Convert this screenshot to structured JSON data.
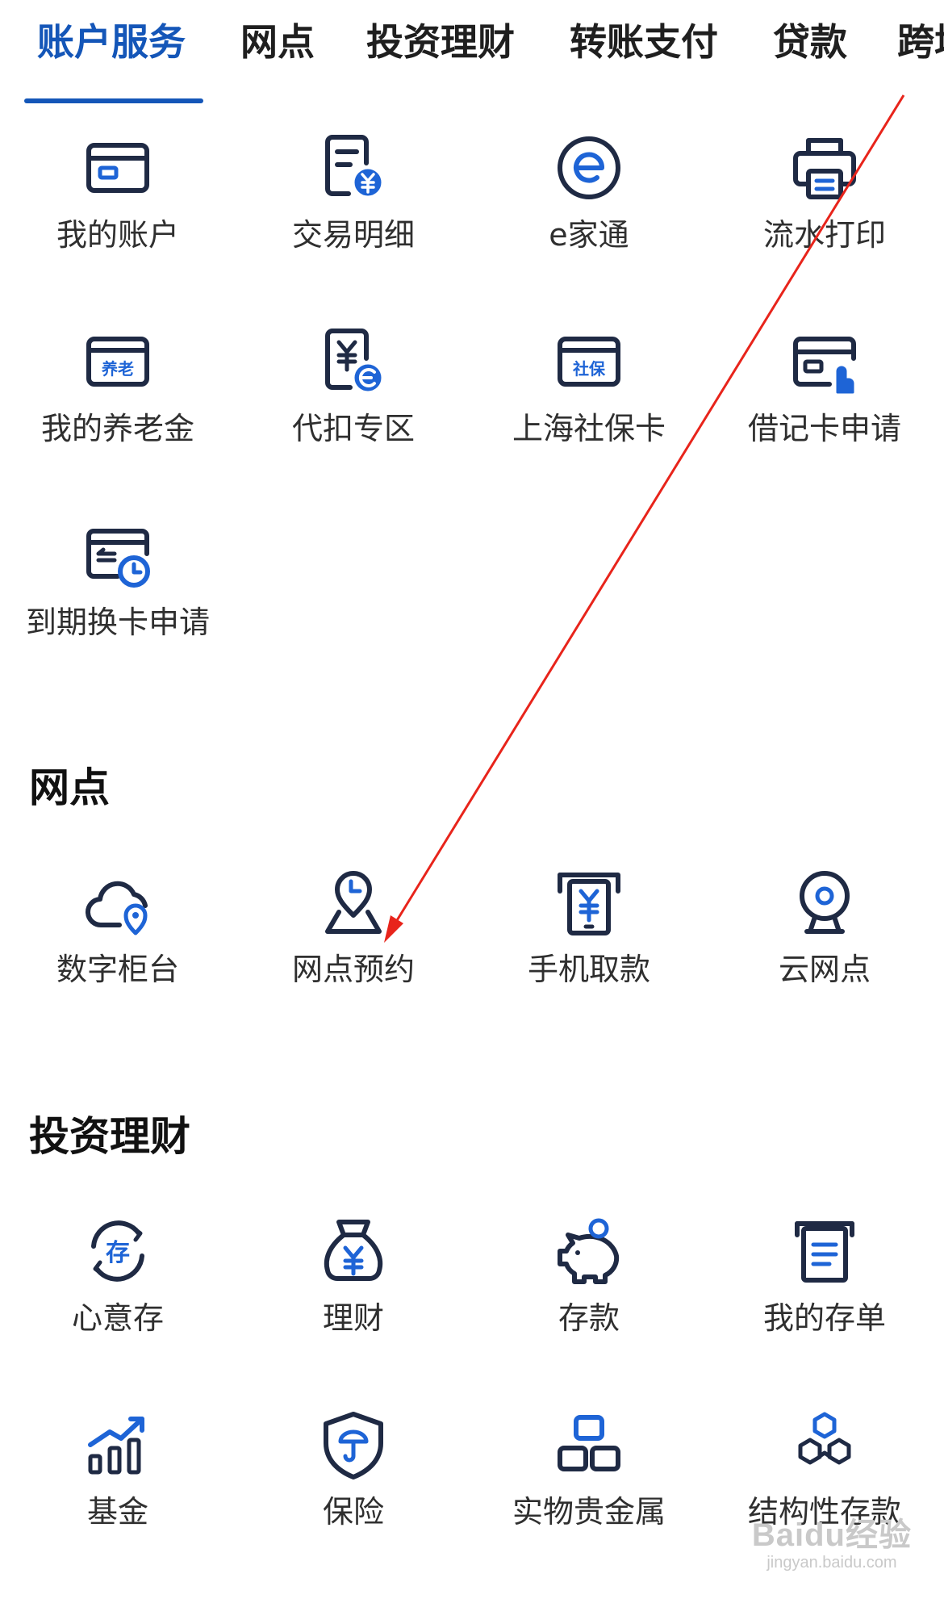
{
  "tabs": [
    {
      "label": "账户服务",
      "active": true
    },
    {
      "label": "网点",
      "active": false
    },
    {
      "label": "投资理财",
      "active": false
    },
    {
      "label": "转账支付",
      "active": false
    },
    {
      "label": "贷款",
      "active": false
    },
    {
      "label": "跨境",
      "active": false
    }
  ],
  "account_services": {
    "items": [
      {
        "label": "我的账户",
        "icon": "card-icon"
      },
      {
        "label": "交易明细",
        "icon": "transaction-detail-icon"
      },
      {
        "label": "e家通",
        "icon": "e-letter-icon"
      },
      {
        "label": "流水打印",
        "icon": "printer-icon"
      },
      {
        "label": "我的养老金",
        "icon": "pension-card-icon",
        "icon_text": "养老"
      },
      {
        "label": "代扣专区",
        "icon": "auto-debit-icon"
      },
      {
        "label": "上海社保卡",
        "icon": "social-security-card-icon",
        "icon_text": "社保"
      },
      {
        "label": "借记卡申请",
        "icon": "debit-card-apply-icon"
      },
      {
        "label": "到期换卡申请",
        "icon": "card-renewal-icon"
      }
    ]
  },
  "branch": {
    "title": "网点",
    "items": [
      {
        "label": "数字柜台",
        "icon": "cloud-location-icon"
      },
      {
        "label": "网点预约",
        "icon": "location-clock-icon"
      },
      {
        "label": "手机取款",
        "icon": "atm-withdraw-icon"
      },
      {
        "label": "云网点",
        "icon": "webcam-icon"
      }
    ]
  },
  "investment": {
    "title": "投资理财",
    "items": [
      {
        "label": "心意存",
        "icon": "deposit-cycle-icon",
        "icon_text": "存"
      },
      {
        "label": "理财",
        "icon": "money-bag-icon"
      },
      {
        "label": "存款",
        "icon": "piggy-bank-icon"
      },
      {
        "label": "我的存单",
        "icon": "certificate-icon"
      },
      {
        "label": "基金",
        "icon": "fund-chart-icon"
      },
      {
        "label": "保险",
        "icon": "insurance-shield-icon"
      },
      {
        "label": "实物贵金属",
        "icon": "gold-bars-icon"
      },
      {
        "label": "结构性存款",
        "icon": "hexagons-icon"
      }
    ]
  },
  "watermark": {
    "brand": "Baidu经验",
    "site": "jingyan.baidu.com"
  },
  "colors": {
    "accent": "#1456b8",
    "icon_dark": "#1f2a44",
    "icon_blue": "#1e64d6",
    "arrow": "#e8241b"
  }
}
